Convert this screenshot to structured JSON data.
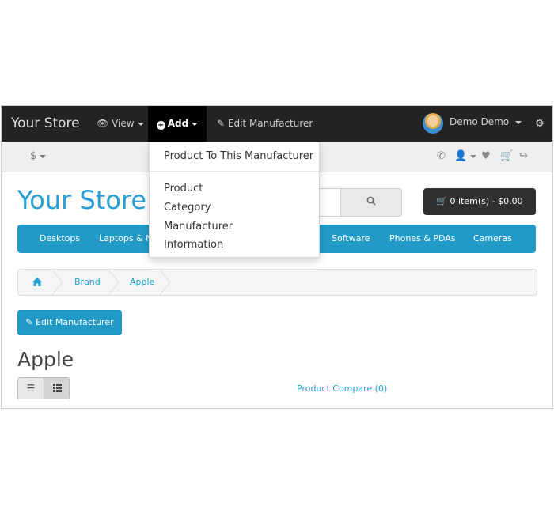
{
  "admin_bar": {
    "store_name": "Your Store",
    "view_label": "View",
    "add_label": "Add",
    "edit_label": "Edit Manufacturer",
    "username": "Demo Demo"
  },
  "add_dropdown": {
    "items": [
      "Product To This Manufacturer",
      "Product",
      "Category",
      "Manufacturer",
      "Information"
    ]
  },
  "top_bar": {
    "currency": "$"
  },
  "header": {
    "logo": "Your Store",
    "cart_label": "0 item(s) - $0.00"
  },
  "menu": {
    "items": [
      "Desktops",
      "Laptops & N",
      "Software",
      "Phones & PDAs",
      "Cameras"
    ]
  },
  "breadcrumb": {
    "items": [
      "Brand",
      "Apple"
    ]
  },
  "content": {
    "edit_button": "Edit Manufacturer",
    "title": "Apple",
    "compare_link": "Product Compare (0)"
  },
  "colors": {
    "accent": "#229ac8",
    "admin_bar": "#232323",
    "link": "#23a1d1"
  }
}
